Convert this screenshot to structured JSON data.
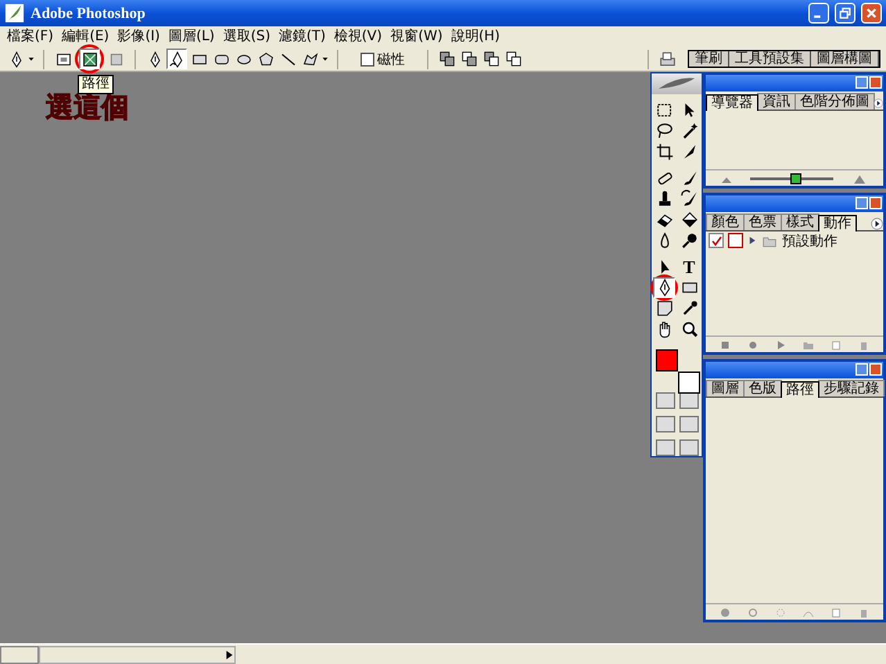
{
  "window": {
    "title": "Adobe Photoshop"
  },
  "menu": [
    {
      "label": "檔案(F)"
    },
    {
      "label": "編輯(E)"
    },
    {
      "label": "影像(I)"
    },
    {
      "label": "圖層(L)"
    },
    {
      "label": "選取(S)"
    },
    {
      "label": "濾鏡(T)"
    },
    {
      "label": "檢視(V)"
    },
    {
      "label": "視窗(W)"
    },
    {
      "label": "說明(H)"
    }
  ],
  "options_bar": {
    "modes": [
      {
        "kind": "shape-layers",
        "selected": false
      },
      {
        "kind": "paths",
        "selected": true
      },
      {
        "kind": "fill-pixels",
        "selected": false
      }
    ],
    "shape_tools": [
      {
        "kind": "pen",
        "selected": false
      },
      {
        "kind": "freeform-pen",
        "selected": true
      },
      {
        "kind": "rectangle",
        "selected": false
      },
      {
        "kind": "rounded-rectangle",
        "selected": false
      },
      {
        "kind": "ellipse",
        "selected": false
      },
      {
        "kind": "polygon",
        "selected": false
      },
      {
        "kind": "line",
        "selected": false
      },
      {
        "kind": "custom-shape",
        "selected": false
      }
    ],
    "checkbox": {
      "label": "磁性",
      "checked": false
    },
    "tooltip": "路徑",
    "palette_well": [
      {
        "label": "筆刷"
      },
      {
        "label": "工具預設集"
      },
      {
        "label": "圖層構圖"
      }
    ]
  },
  "annotation": {
    "text": "選這個"
  },
  "toolbox": {
    "type_glyph": "T",
    "tools": [
      {
        "kind": "marquee",
        "selected": false
      },
      {
        "kind": "move",
        "selected": false
      },
      {
        "kind": "lasso",
        "selected": false
      },
      {
        "kind": "wand",
        "selected": false
      },
      {
        "kind": "crop",
        "selected": false
      },
      {
        "kind": "knife",
        "selected": false
      },
      {
        "kind": "bandage",
        "selected": false
      },
      {
        "kind": "brush",
        "selected": false
      },
      {
        "kind": "stamp",
        "selected": false
      },
      {
        "kind": "history-brush",
        "selected": false
      },
      {
        "kind": "eraser",
        "selected": false
      },
      {
        "kind": "bucket",
        "selected": false
      },
      {
        "kind": "droplet",
        "selected": false
      },
      {
        "kind": "dodge",
        "selected": false
      },
      {
        "kind": "arrow",
        "selected": false
      },
      {
        "kind": "type",
        "selected": false
      },
      {
        "kind": "pen",
        "selected": true
      },
      {
        "kind": "rectangle",
        "selected": false
      },
      {
        "kind": "note",
        "selected": false
      },
      {
        "kind": "eyedropper",
        "selected": false
      },
      {
        "kind": "hand",
        "selected": false
      },
      {
        "kind": "zoom",
        "selected": false
      }
    ],
    "swatches": [
      {
        "kind": "foreground",
        "color": "#ff0000"
      },
      {
        "kind": "background",
        "color": "#ffffff"
      }
    ]
  },
  "palettes": [
    {
      "kind": "navigator",
      "tabs": [
        {
          "label": "導覽器",
          "selected": true
        },
        {
          "label": "資訊",
          "selected": false
        },
        {
          "label": "色階分佈圖",
          "selected": false
        }
      ],
      "zoom_slider": {
        "level": 0.55
      }
    },
    {
      "kind": "actions",
      "tabs": [
        {
          "label": "顏色",
          "selected": false
        },
        {
          "label": "色票",
          "selected": false
        },
        {
          "label": "樣式",
          "selected": false
        },
        {
          "label": "動作",
          "selected": true
        }
      ],
      "actions": [
        {
          "label": "預設動作",
          "checked": true,
          "expanded": false
        }
      ]
    },
    {
      "kind": "paths",
      "tabs": [
        {
          "label": "圖層",
          "selected": false
        },
        {
          "label": "色版",
          "selected": false
        },
        {
          "label": "路徑",
          "selected": true
        },
        {
          "label": "步驟記錄",
          "selected": false
        }
      ]
    }
  ]
}
